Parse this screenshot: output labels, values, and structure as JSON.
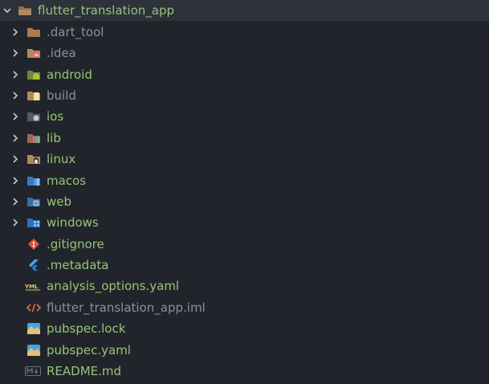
{
  "root": {
    "label": "flutter_translation_app",
    "expanded": true
  },
  "folders": [
    {
      "label": ".dart_tool",
      "icon": "dart-folder-icon",
      "color": "#8b919c"
    },
    {
      "label": ".idea",
      "icon": "idea-folder-icon",
      "color": "#8b919c"
    },
    {
      "label": "android",
      "icon": "android-folder-icon",
      "color": "#98c379"
    },
    {
      "label": "build",
      "icon": "build-folder-icon",
      "color": "#8b919c"
    },
    {
      "label": "ios",
      "icon": "ios-folder-icon",
      "color": "#98c379"
    },
    {
      "label": "lib",
      "icon": "lib-folder-icon",
      "color": "#98c379"
    },
    {
      "label": "linux",
      "icon": "linux-folder-icon",
      "color": "#98c379"
    },
    {
      "label": "macos",
      "icon": "macos-folder-icon",
      "color": "#98c379"
    },
    {
      "label": "web",
      "icon": "web-folder-icon",
      "color": "#98c379"
    },
    {
      "label": "windows",
      "icon": "windows-folder-icon",
      "color": "#98c379"
    }
  ],
  "files": [
    {
      "label": ".gitignore",
      "icon": "git-icon",
      "color": "#98c379"
    },
    {
      "label": ".metadata",
      "icon": "flutter-icon",
      "color": "#98c379"
    },
    {
      "label": "analysis_options.yaml",
      "icon": "yaml-icon",
      "color": "#98c379"
    },
    {
      "label": "flutter_translation_app.iml",
      "icon": "code-icon",
      "color": "#8b919c"
    },
    {
      "label": "pubspec.lock",
      "icon": "pubspec-icon",
      "color": "#98c379"
    },
    {
      "label": "pubspec.yaml",
      "icon": "pubspec-icon",
      "color": "#98c379"
    },
    {
      "label": "README.md",
      "icon": "markdown-icon",
      "color": "#98c379"
    }
  ],
  "colors": {
    "background": "#21252b",
    "root_row": "#2c313a",
    "tracked_text": "#98c379",
    "ignored_text": "#8b919c"
  }
}
